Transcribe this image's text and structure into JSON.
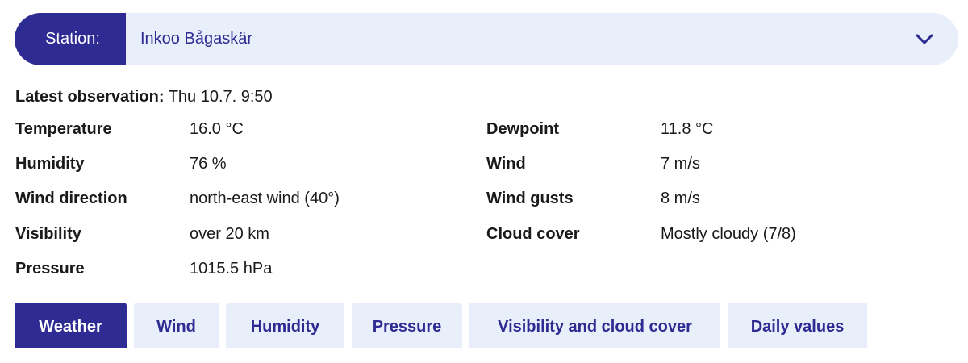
{
  "station": {
    "label": "Station:",
    "value": "Inkoo Bågaskär",
    "dropdown_icon": "chevron-down-icon"
  },
  "latest": {
    "label": "Latest observation:",
    "value": "Thu 10.7. 9:50"
  },
  "observations_left": [
    {
      "label": "Temperature",
      "value": "16.0 °C"
    },
    {
      "label": "Humidity",
      "value": "76 %"
    },
    {
      "label": "Wind direction",
      "value": "north-east wind (40°)"
    },
    {
      "label": "Visibility",
      "value": "over 20 km"
    },
    {
      "label": "Pressure",
      "value": "1015.5 hPa"
    }
  ],
  "observations_right": [
    {
      "label": "Dewpoint",
      "value": "11.8 °C"
    },
    {
      "label": "Wind",
      "value": "7 m/s"
    },
    {
      "label": "Wind gusts",
      "value": "8 m/s"
    },
    {
      "label": "Cloud cover",
      "value": "Mostly cloudy (7/8)"
    }
  ],
  "tabs": [
    {
      "label": "Weather",
      "active": true
    },
    {
      "label": "Wind",
      "active": false
    },
    {
      "label": "Humidity",
      "active": false
    },
    {
      "label": "Pressure",
      "active": false
    },
    {
      "label": "Visibility and cloud cover",
      "active": false
    },
    {
      "label": "Daily values",
      "active": false
    }
  ],
  "colors": {
    "accent": "#2e2b93",
    "light_bg": "#e8eefa"
  }
}
